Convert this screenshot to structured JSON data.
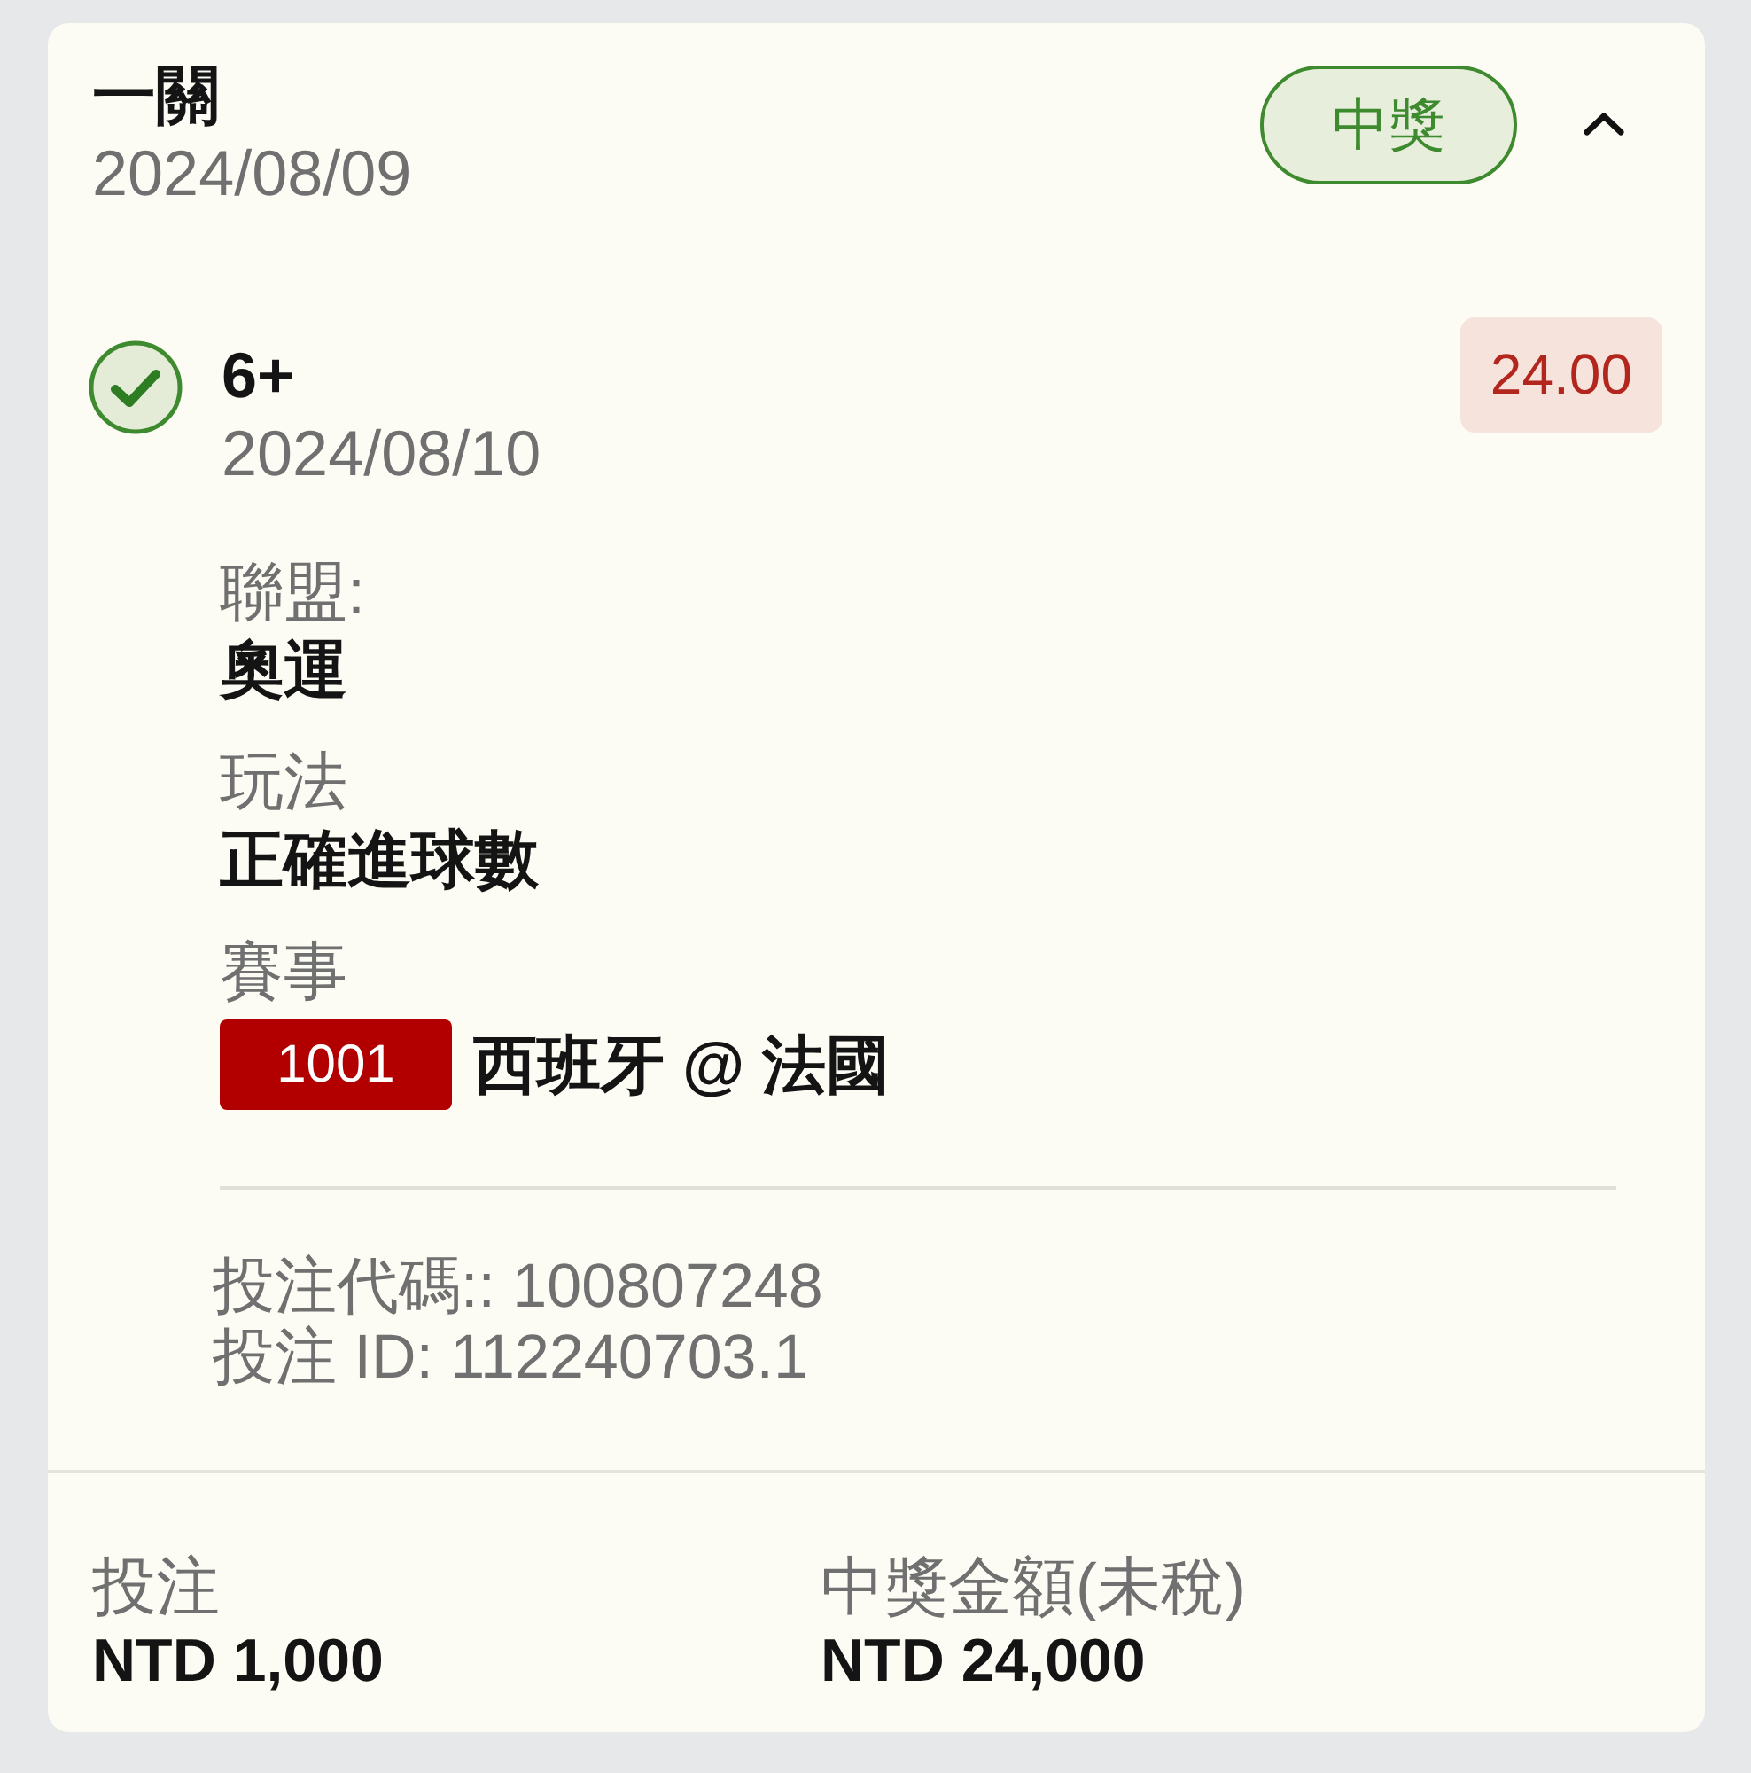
{
  "bet": {
    "title": "一關",
    "date": "2024/08/09",
    "status_label": "中獎",
    "won": true,
    "expanded": true
  },
  "selection": {
    "won": true,
    "name": "6+",
    "date": "2024/08/10",
    "odds": "24.00"
  },
  "details": [
    {
      "kind": "text",
      "label": "聯盟:",
      "value": "奧運"
    },
    {
      "kind": "text",
      "label": "玩法",
      "value": "正確進球數"
    },
    {
      "kind": "match",
      "label": "賽事",
      "match_number": "1001",
      "value": "西班牙 @ 法國"
    }
  ],
  "references": [
    "投注代碼:: 100807248",
    "投注 ID: 112240703.1"
  ],
  "summary": [
    {
      "label": "投注",
      "value": "NTD 1,000"
    },
    {
      "label": "中獎金額(未稅)",
      "value": "NTD 24,000"
    }
  ]
}
